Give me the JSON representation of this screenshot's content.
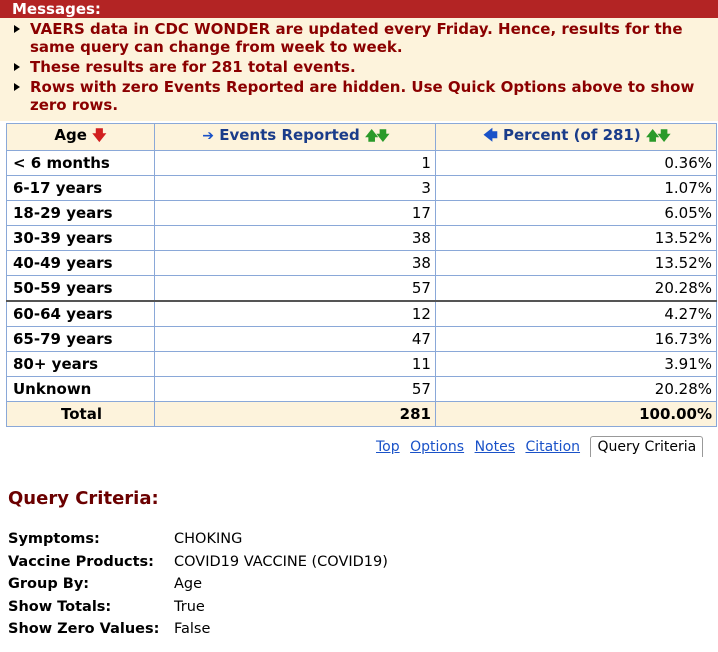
{
  "messages": {
    "header": "Messages:",
    "items": [
      "VAERS data in CDC WONDER are updated every Friday. Hence, results for the same query can change from week to week.",
      "These results are for 281 total events.",
      "Rows with zero Events Reported are hidden. Use Quick Options above to show zero rows."
    ]
  },
  "table": {
    "headers": {
      "age": "Age",
      "events": "Events Reported",
      "percent": "Percent (of 281)"
    },
    "rows": [
      {
        "age": "< 6 months",
        "events": "1",
        "percent": "0.36%"
      },
      {
        "age": "6-17 years",
        "events": "3",
        "percent": "1.07%"
      },
      {
        "age": "18-29 years",
        "events": "17",
        "percent": "6.05%"
      },
      {
        "age": "30-39 years",
        "events": "38",
        "percent": "13.52%"
      },
      {
        "age": "40-49 years",
        "events": "38",
        "percent": "13.52%"
      },
      {
        "age": "50-59 years",
        "events": "57",
        "percent": "20.28%"
      },
      {
        "age": "60-64 years",
        "events": "12",
        "percent": "4.27%"
      },
      {
        "age": "65-79 years",
        "events": "47",
        "percent": "16.73%"
      },
      {
        "age": "80+ years",
        "events": "11",
        "percent": "3.91%"
      },
      {
        "age": "Unknown",
        "events": "57",
        "percent": "20.28%"
      }
    ],
    "total": {
      "label": "Total",
      "events": "281",
      "percent": "100.00%"
    }
  },
  "nav": {
    "top": "Top",
    "options": "Options",
    "notes": "Notes",
    "citation": "Citation",
    "query_criteria": "Query Criteria"
  },
  "query_criteria": {
    "title": "Query Criteria:",
    "items": [
      {
        "key": "Symptoms:",
        "value": "CHOKING"
      },
      {
        "key": "Vaccine Products:",
        "value": "COVID19 VACCINE (COVID19)"
      },
      {
        "key": "Group By:",
        "value": "Age"
      },
      {
        "key": "Show Totals:",
        "value": "True"
      },
      {
        "key": "Show Zero Values:",
        "value": "False"
      }
    ]
  },
  "colors": {
    "message_header_bg": "#b32424",
    "message_text": "#8b0000",
    "header_bg": "#fdf3dc",
    "link": "#1a52c8"
  }
}
